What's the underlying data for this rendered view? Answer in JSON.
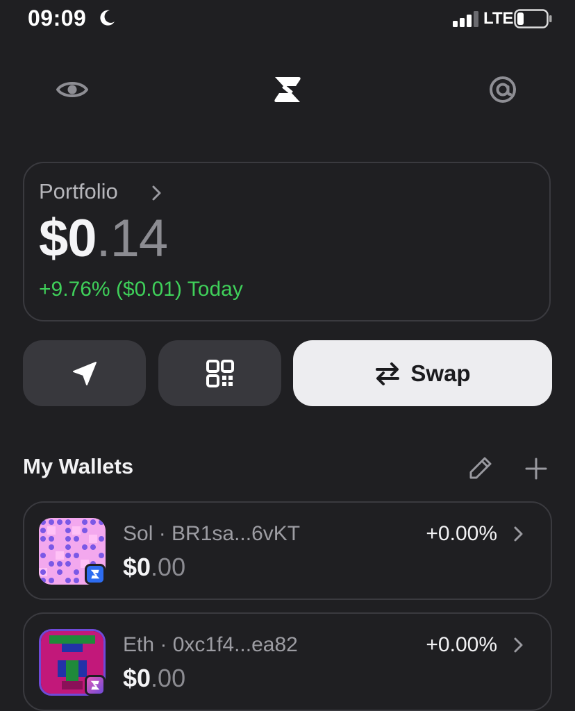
{
  "status_bar": {
    "time": "09:09",
    "network": "LTE",
    "icons": [
      "moon-icon",
      "signal-icon",
      "battery-icon"
    ]
  },
  "nav": {
    "icons": [
      "eye-icon",
      "app-logo-icon",
      "at-sign-icon"
    ]
  },
  "portfolio": {
    "label": "Portfolio",
    "value_main": "$0",
    "value_decimal": ".14",
    "change": "+9.76% ($0.01) Today",
    "change_color": "#3fd05a"
  },
  "actions": {
    "send_icon": "send-icon",
    "receive_icon": "qr-code-icon",
    "swap_label": "Swap"
  },
  "wallets": {
    "title": "My Wallets",
    "items": [
      {
        "name": "Sol · BR1sa...6vKT",
        "balance_main": "$0",
        "balance_decimal": ".00",
        "change": "+0.00%"
      },
      {
        "name": "Eth · 0xc1f4...ea82",
        "balance_main": "$0",
        "balance_decimal": ".00",
        "change": "+0.00%"
      }
    ]
  },
  "colors": {
    "background": "#1f1f22",
    "card_border": "#3a3a3f",
    "button": "#38383d",
    "swap_button": "#ededf0",
    "positive": "#3fd05a"
  }
}
